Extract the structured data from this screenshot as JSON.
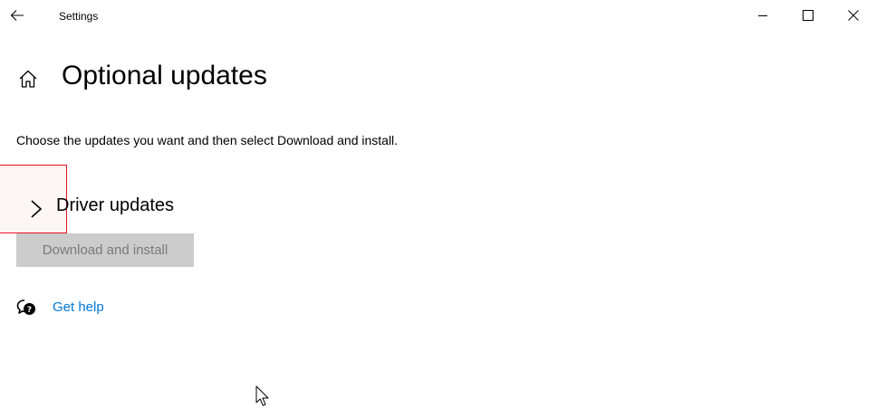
{
  "window": {
    "title": "Settings",
    "controls": {
      "minimize_icon": "minimize-icon",
      "maximize_icon": "maximize-icon",
      "close_icon": "close-icon"
    }
  },
  "page": {
    "title": "Optional updates",
    "description": "Choose the updates you want and then select Download and install."
  },
  "driver_updates": {
    "label": "Driver updates",
    "expanded": false
  },
  "actions": {
    "download_label": "Download and install",
    "download_enabled": false
  },
  "help": {
    "label": "Get help"
  },
  "colors": {
    "accent": "#0078d7",
    "focus_border": "#e81123",
    "disabled_button_bg": "#cccccc",
    "disabled_button_text": "#7a7a7a"
  }
}
